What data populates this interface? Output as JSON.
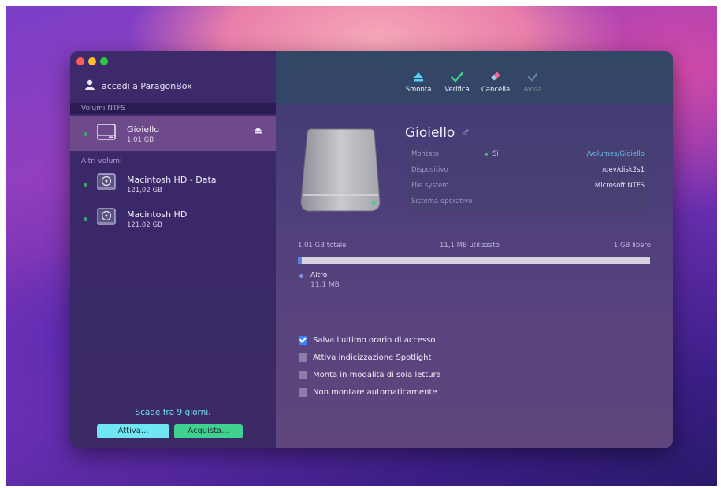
{
  "sidebar": {
    "account_label": "accedi a ParagonBox",
    "ntfs_header": "Volumi NTFS",
    "other_header": "Altri volumi",
    "volumes": [
      {
        "name": "Gioiello",
        "size": "1,01 GB"
      },
      {
        "name": "Macintosh HD - Data",
        "size": "121,02 GB"
      },
      {
        "name": "Macintosh HD",
        "size": "121,02 GB"
      }
    ],
    "expire_text": "Scade fra 9 giorni.",
    "activate_label": "Attiva...",
    "buy_label": "Acquista..."
  },
  "toolbar": {
    "unmount": "Smonta",
    "verify": "Verifica",
    "erase": "Cancella",
    "mount": "Avvia"
  },
  "volume": {
    "title": "Gioiello",
    "rows": [
      {
        "key": "Montato",
        "mid": "Sì",
        "value": "/Volumes/Gioiello"
      },
      {
        "key": "Dispositivo",
        "value": "/dev/disk2s1"
      },
      {
        "key": "File system",
        "value": "Microsoft NTFS"
      },
      {
        "key": "Sistema operativo",
        "value": ""
      }
    ]
  },
  "usage": {
    "total": "1,01 GB totale",
    "used": "11,1 MB utilizzato",
    "free": "1 GB libero",
    "used_fraction": 0.011,
    "legend_label": "Altro",
    "legend_size": "11,1 MB"
  },
  "options": [
    {
      "label": "Salva l'ultimo orario di accesso",
      "checked": true
    },
    {
      "label": "Attiva indicizzazione Spotlight",
      "checked": false
    },
    {
      "label": "Monta in modalità di sola lettura",
      "checked": false
    },
    {
      "label": "Non montare automaticamente",
      "checked": false
    }
  ],
  "colors": {
    "accent_blue": "#3b82f6",
    "link": "#6ab8f0",
    "expire_text": "#6fe0ec",
    "activate_button": "#6fe6f2",
    "buy_button": "#3fd18f"
  }
}
